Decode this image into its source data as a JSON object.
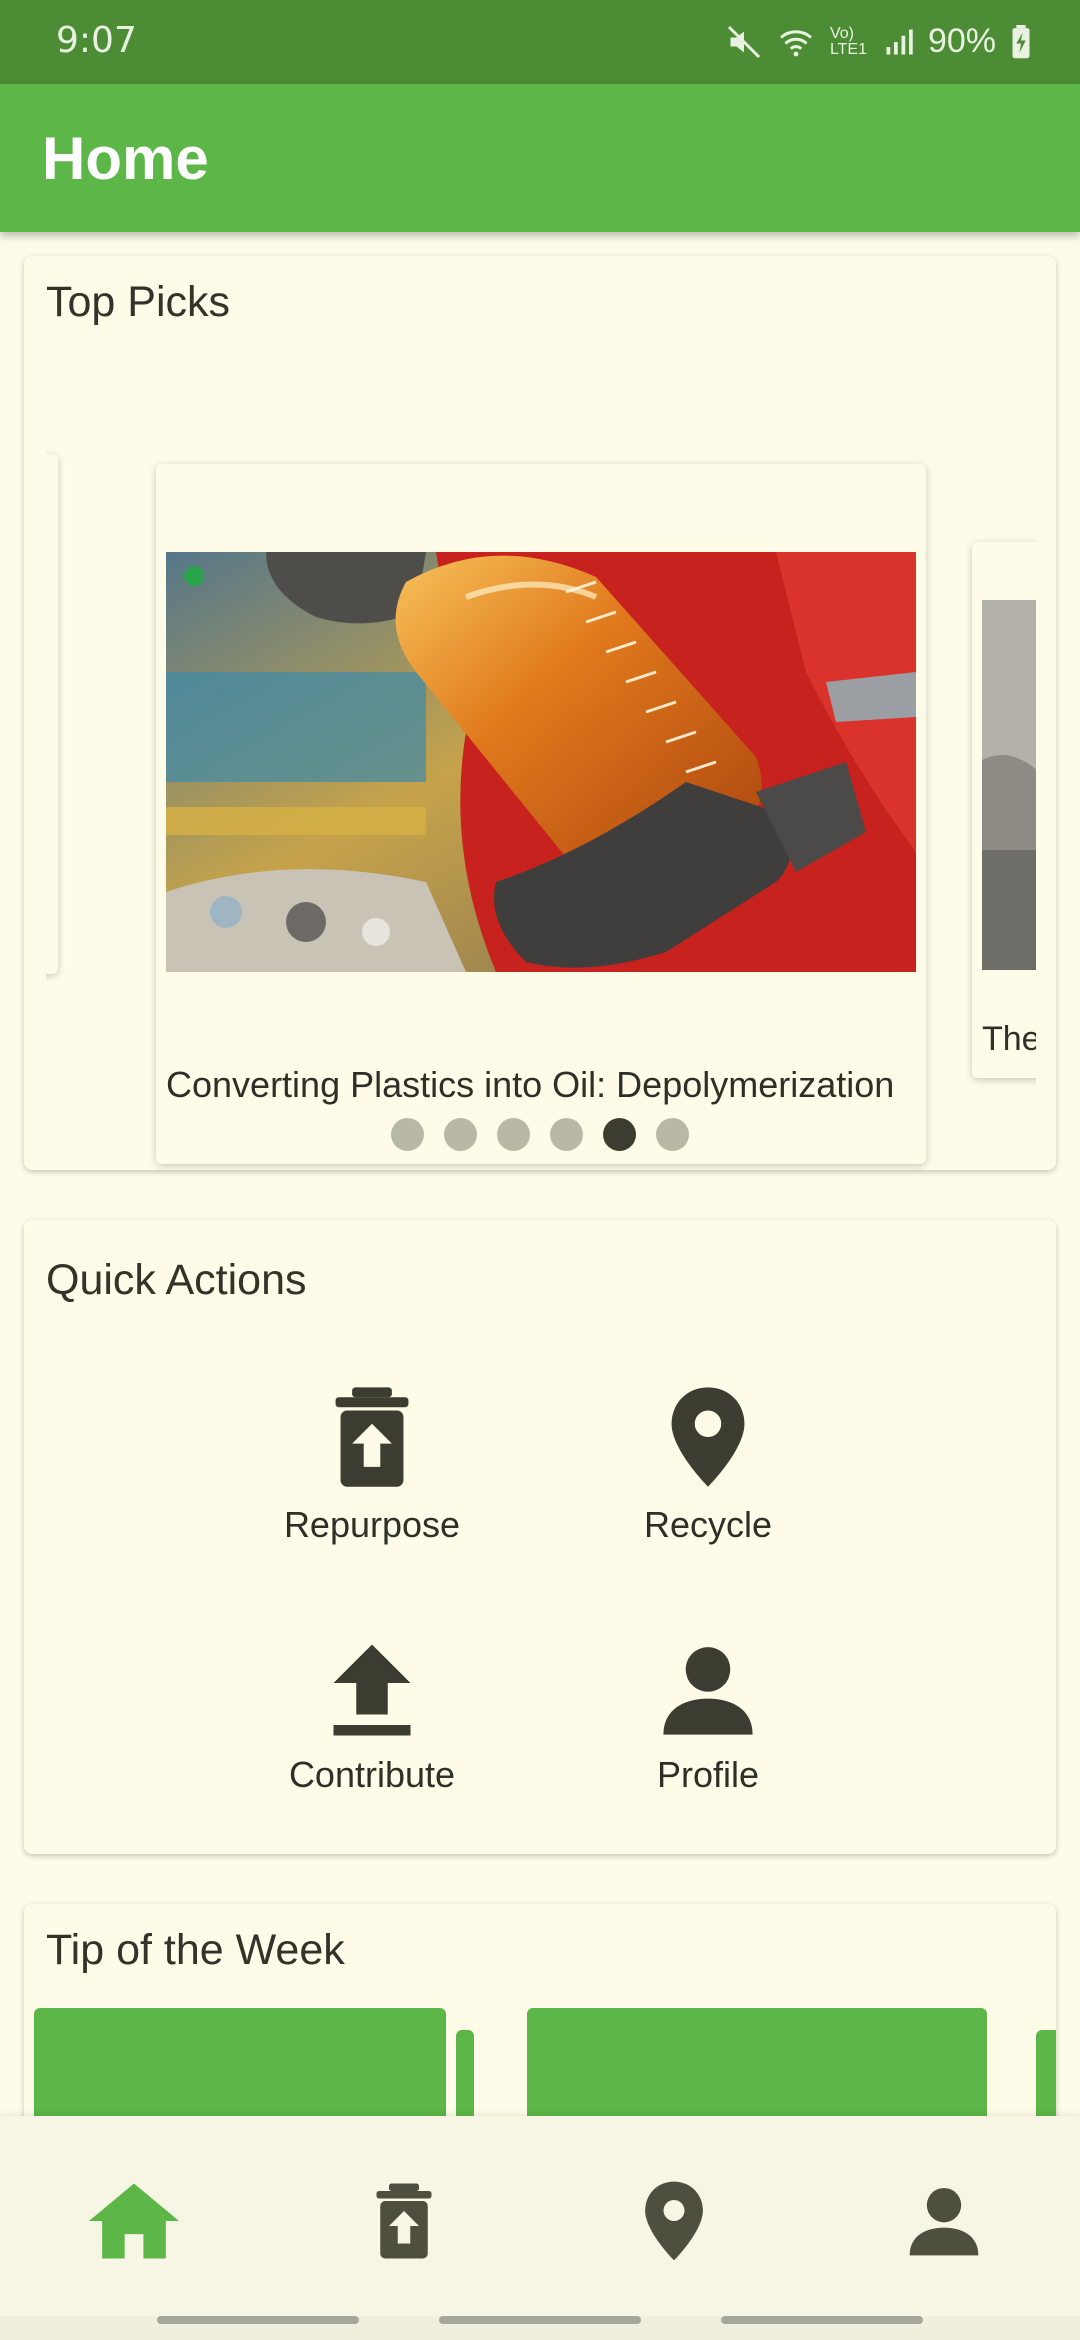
{
  "status_bar": {
    "time": "9:07",
    "battery": "90%",
    "network_label": "Vo) LTE1"
  },
  "app_bar": {
    "title": "Home"
  },
  "top_picks": {
    "title": "Top Picks",
    "slides": [
      {
        "caption": ""
      },
      {
        "caption": "Converting Plastics into Oil: Depolymerization"
      },
      {
        "caption": "The"
      }
    ],
    "dots_count": 6,
    "active_dot": 5
  },
  "quick_actions": {
    "title": "Quick Actions",
    "items": [
      {
        "label": "Repurpose",
        "icon": "delete-upload-icon"
      },
      {
        "label": "Recycle",
        "icon": "location-pin-icon"
      },
      {
        "label": "Contribute",
        "icon": "upload-icon"
      },
      {
        "label": "Profile",
        "icon": "person-icon"
      }
    ]
  },
  "tip_of_week": {
    "title": "Tip of the Week"
  },
  "bottom_nav": {
    "items": [
      {
        "icon": "home-icon",
        "active": true
      },
      {
        "icon": "delete-upload-icon",
        "active": false
      },
      {
        "icon": "location-pin-icon",
        "active": false
      },
      {
        "icon": "person-icon",
        "active": false
      }
    ]
  },
  "colors": {
    "primary": "#5cb648",
    "status_bar": "#4c8c35",
    "background": "#fdfbe9",
    "icon_dark": "#3c3c30"
  }
}
